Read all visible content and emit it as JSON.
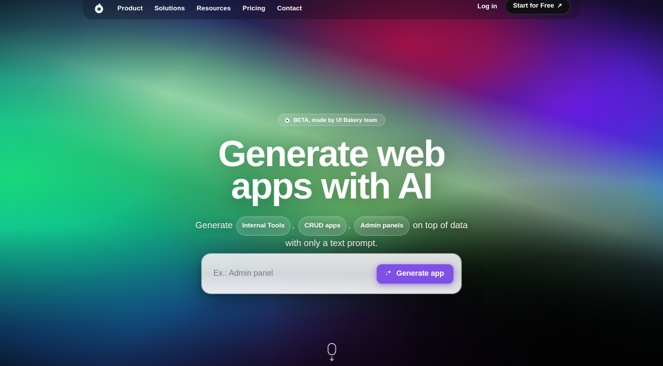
{
  "brand": {
    "name": "UI Bakery",
    "logo_icon": "ui-bakery-logo-icon"
  },
  "theme": {
    "accent_purple": "#7e50e6",
    "nav_cta_bg": "#101014",
    "text_on_dark": "#ffffff",
    "prompt_card_bg": "#ecedef",
    "placeholder_color": "#7b7b80"
  },
  "nav": {
    "links": [
      {
        "label": "Product"
      },
      {
        "label": "Solutions"
      },
      {
        "label": "Resources"
      },
      {
        "label": "Pricing"
      },
      {
        "label": "Contact"
      }
    ],
    "login_label": "Log in",
    "cta_label": "Start for Free",
    "cta_arrow": "↗",
    "cta_arrow_icon": "arrow-up-right-icon"
  },
  "hero": {
    "badge": {
      "text": "BETA, made by UI Bakery team",
      "icon": "ui-bakery-logo-icon"
    },
    "title_line1": "Generate web",
    "title_line2": "apps with AI",
    "sub_prefix": "Generate",
    "tags": [
      {
        "label": "Internal Tools"
      },
      {
        "label": "CRUD apps"
      },
      {
        "label": "Admin panels"
      }
    ],
    "tag_separator": ",",
    "sub_suffix": "on top of data",
    "sub_line2": "with only a text prompt."
  },
  "prompt": {
    "placeholder": "Ex.: Admin panel",
    "value": "",
    "button_label": "Generate app",
    "button_icon": "sparkle-icon"
  },
  "scroll_hint": {
    "mouse_icon": "mouse-icon",
    "arrow_icon": "chevron-down-icon"
  }
}
